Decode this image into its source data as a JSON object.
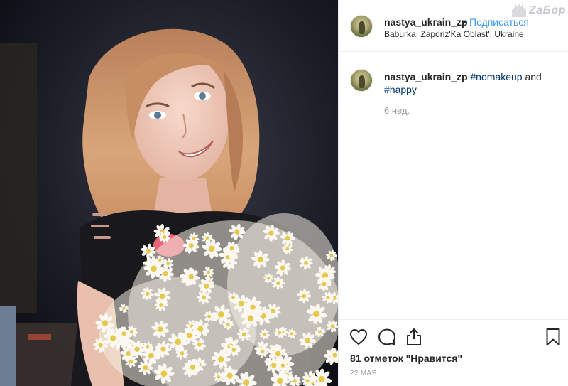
{
  "post": {
    "username": "nastya_ukrain_zp",
    "separator": "•",
    "follow_label": "Подписаться",
    "location": "Baburka, Zaporiz'Ka Oblast', Ukraine",
    "watermark": "ZaБор"
  },
  "caption": {
    "username": "nastya_ukrain_zp",
    "tag1": "#nomakeup",
    "and_word": "and",
    "tag2": "#happy",
    "time": "6 нед."
  },
  "actions": {
    "likes_text": "81 отметок \"Нравится\"",
    "date": "22 мая"
  },
  "icons": {
    "like": "heart-icon",
    "comment": "comment-bubble-icon",
    "share": "share-icon",
    "save": "bookmark-icon"
  },
  "colors": {
    "link": "#3897f0",
    "hashtag": "#003569",
    "muted": "#999999",
    "text": "#262626"
  }
}
